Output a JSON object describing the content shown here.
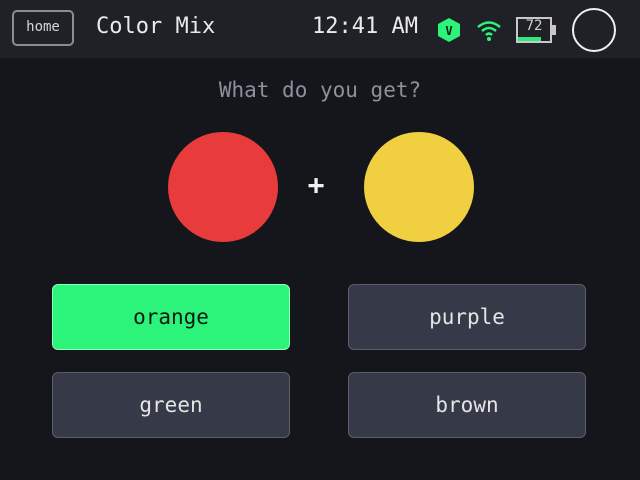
{
  "status_bar": {
    "home_label": "home",
    "app_title": "Color Mix",
    "time": "12:41 AM",
    "badge_letter": "V",
    "wifi_icon": "wifi-icon",
    "battery_level": "72",
    "battery_fraction": 0.72
  },
  "quiz": {
    "question": "What do you get?",
    "operator": "+",
    "color_a": "#e83c3c",
    "color_b": "#f0d040",
    "choices": [
      {
        "label": "orange",
        "selected": true
      },
      {
        "label": "purple",
        "selected": false
      },
      {
        "label": "green",
        "selected": false
      },
      {
        "label": "brown",
        "selected": false
      }
    ]
  },
  "colors": {
    "background": "#15161b",
    "topbar": "#1f2127",
    "accent_green": "#2cf47a",
    "button_bg": "#363a48"
  }
}
